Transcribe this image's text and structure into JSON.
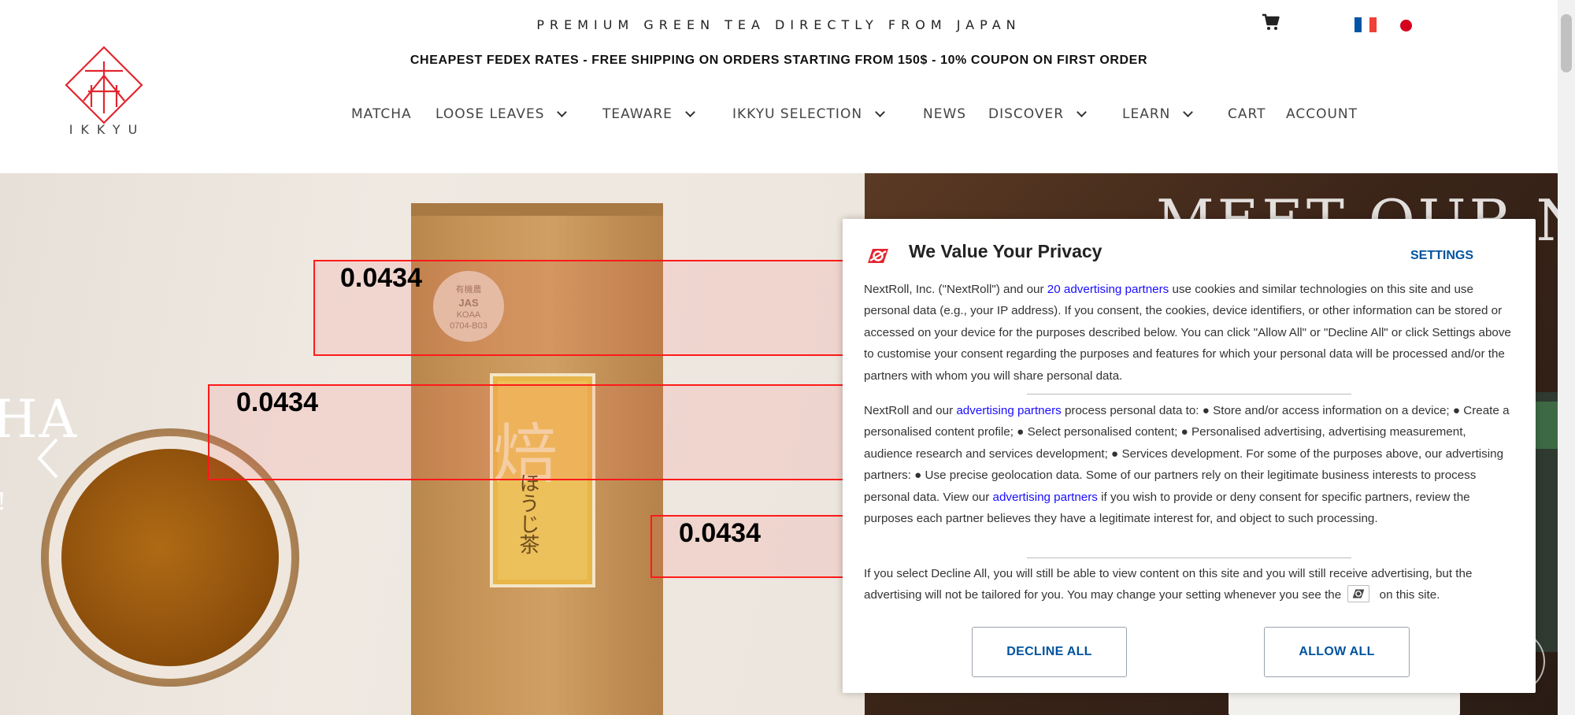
{
  "header": {
    "tagline": "PREMIUM GREEN TEA DIRECTLY FROM JAPAN",
    "shipping_banner": "CHEAPEST FEDEX RATES - FREE SHIPPING ON ORDERS STARTING FROM 150$ - 10% COUPON ON FIRST ORDER",
    "logo_text": "IKKYU",
    "cart_icon": "cart-icon",
    "languages": [
      "fr-flag-icon",
      "jp-flag-icon"
    ]
  },
  "nav": {
    "items": [
      {
        "label": "MATCHA",
        "has_dropdown": false
      },
      {
        "label": "LOOSE LEAVES",
        "has_dropdown": true
      },
      {
        "label": "TEAWARE",
        "has_dropdown": true
      },
      {
        "label": "IKKYU SELECTION",
        "has_dropdown": true
      },
      {
        "label": "NEWS",
        "has_dropdown": false
      },
      {
        "label": "DISCOVER",
        "has_dropdown": true
      },
      {
        "label": "LEARN",
        "has_dropdown": true
      },
      {
        "label": "CART",
        "has_dropdown": false
      },
      {
        "label": "ACCOUNT",
        "has_dropdown": false
      }
    ]
  },
  "hero": {
    "side_text": "HA",
    "side_text_small": "!",
    "right_title": "MEET OUR NE",
    "bag_kanji": "焙",
    "bag_sub": "ほうじ茶",
    "jas_lines": [
      "有機農",
      "JAS",
      "KOAA",
      "0704-B03"
    ],
    "prev_arrow_icon": "chevron-left-icon"
  },
  "detections": [
    {
      "label": "0.0434"
    },
    {
      "label": "0.0434"
    },
    {
      "label": "0.0434"
    }
  ],
  "privacy": {
    "title": "We Value Your Privacy",
    "settings_label": "SETTINGS",
    "p1_a": "NextRoll, Inc. (\"NextRoll\") and our ",
    "p1_link": "20 advertising partners",
    "p1_b": " use cookies and similar technologies on this site and use personal data (e.g., your IP address). If you consent, the cookies, device identifiers, or other information can be stored or accessed on your device for the purposes described below. You can click \"Allow All\" or \"Decline All\" or click Settings above to customise your consent regarding the purposes and features for which your personal data will be processed and/or the partners with whom you will share personal data.",
    "p2_a": "NextRoll and our ",
    "p2_link1": "advertising partners",
    "p2_b": " process personal data to: ● Store and/or access information on a device; ● Create a personalised content profile; ● Select personalised content; ● Personalised advertising, advertising measurement, audience research and services development; ● Services development. For some of the purposes above, our advertising partners: ● Use precise geolocation data. Some of our partners rely on their legitimate business interests to process personal data. View our ",
    "p2_link2": "advertising partners",
    "p2_c": " if you wish to provide or deny consent for specific partners, review the purposes each partner believes they have a legitimate interest for, and object to such processing.",
    "p3_a": "If you select Decline All, you will still be able to view content on this site and you will still receive advertising, but the advertising will not be tailored for you. You may change your setting whenever you see the ",
    "p3_b": " on this site.",
    "decline_label": "DECLINE ALL",
    "allow_label": "ALLOW ALL",
    "brand_color": "#e3262f",
    "link_color": "#1a0dff",
    "button_text_color": "#00539f"
  },
  "colors": {
    "flag_fr": [
      "#0055a4",
      "#ffffff",
      "#ef4135"
    ],
    "flag_jp_dot": "#d4001d",
    "logo_red": "#e3262f",
    "detection_box": "#ff1a1a"
  }
}
